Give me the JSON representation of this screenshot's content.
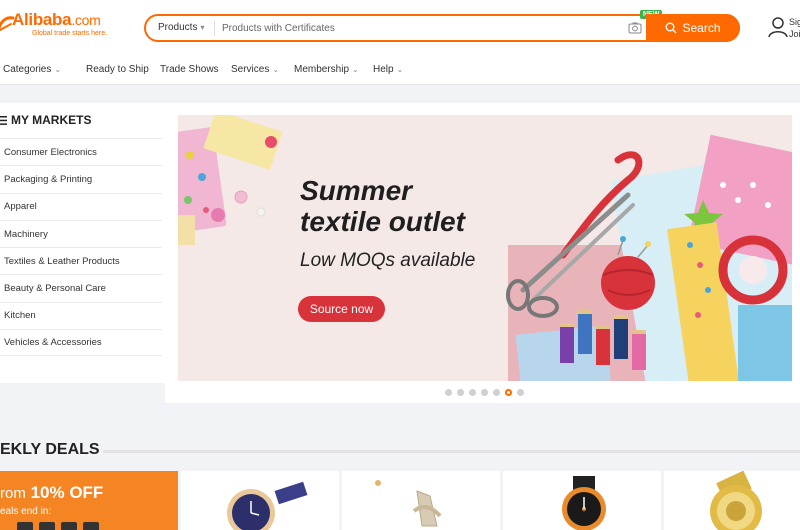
{
  "header": {
    "logo_text": "Alibaba",
    "logo_domain": ".com",
    "logo_tagline": "Global trade starts here.",
    "search_category": "Products",
    "search_placeholder": "Products with Certificates",
    "search_button": "Search",
    "new_badge": "NEW",
    "signin_line1": "Sig",
    "signin_line2": "Joi"
  },
  "nav": {
    "items": [
      {
        "label": "Categories",
        "dropdown": true
      },
      {
        "label": "Ready to Ship",
        "dropdown": false
      },
      {
        "label": "Trade Shows",
        "dropdown": false
      },
      {
        "label": "Services",
        "dropdown": true
      },
      {
        "label": "Membership",
        "dropdown": true
      },
      {
        "label": "Help",
        "dropdown": true
      }
    ]
  },
  "markets": {
    "title": "MY MARKETS",
    "items": [
      "Consumer Electronics",
      "Packaging & Printing",
      "Apparel",
      "Machinery",
      "Textiles & Leather Products",
      "Beauty & Personal Care",
      "Kitchen",
      "Vehicles & Accessories"
    ]
  },
  "banner": {
    "title_line1": "Summer",
    "title_line2": "textile outlet",
    "subtitle": "Low MOQs available",
    "cta": "Source now",
    "slide_count": 7,
    "active_slide": 5
  },
  "deals": {
    "title": "EKLY DEALS",
    "promo_from": "rom",
    "promo_percent": "10% OFF",
    "promo_sub": "eals end in:"
  },
  "colors": {
    "accent": "#ff6a00",
    "cta_red": "#d8323a",
    "promo_orange": "#f58523"
  }
}
